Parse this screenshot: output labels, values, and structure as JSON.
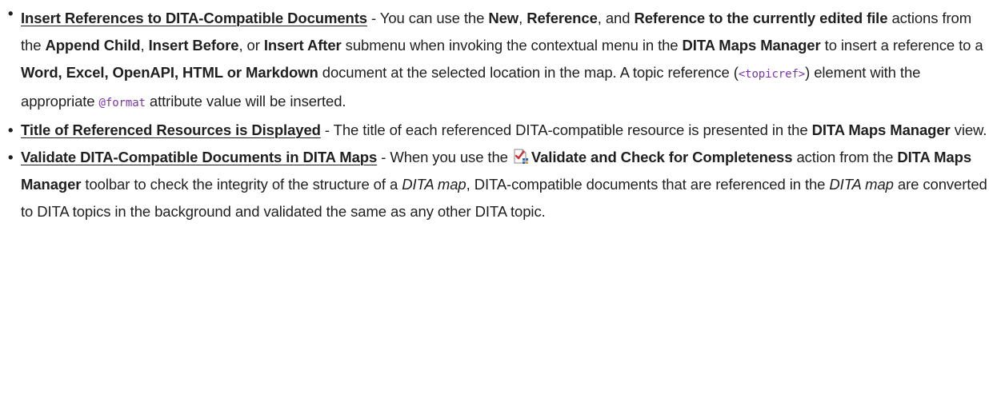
{
  "items": [
    {
      "link": "Insert References to DITA-Compatible Documents",
      "t": [
        " - You can use the ",
        "New",
        ", ",
        "Reference",
        ", and ",
        "Reference to the currently edited file",
        " actions from the ",
        "Append Child",
        ", ",
        "Insert Before",
        ", or ",
        "Insert After",
        " submenu when invoking the contextual menu in the ",
        "DITA Maps Manager",
        " to insert a reference to a ",
        "Word, Excel, OpenAPI, HTML or Markdown",
        " document at the selected location in the map. A topic reference (",
        "<topicref>",
        ") element with the appropriate ",
        "@format",
        " attribute value will be inserted."
      ]
    },
    {
      "link": "Title of Referenced Resources is Displayed",
      "t": [
        " - The title of each referenced DITA-compatible resource is presented in the ",
        "DITA Maps Manager",
        " view."
      ]
    },
    {
      "link": "Validate DITA-Compatible Documents in DITA Maps",
      "icon": "validate-check-icon",
      "t": [
        " - When you use the ",
        "Validate and Check for Completeness",
        " action from the ",
        "DITA Maps Manager",
        " toolbar to check the integrity of the structure of a ",
        "DITA map",
        ", DITA-compatible documents that are referenced in the ",
        "DITA map",
        " are converted to DITA topics in the background and validated the same as any other DITA topic."
      ]
    }
  ],
  "bullet": "•",
  "colors": {
    "text": "#1f1f1f",
    "code": "#7a35a8",
    "icon_red": "#d32f2f",
    "icon_blue": "#1e6fd9"
  }
}
